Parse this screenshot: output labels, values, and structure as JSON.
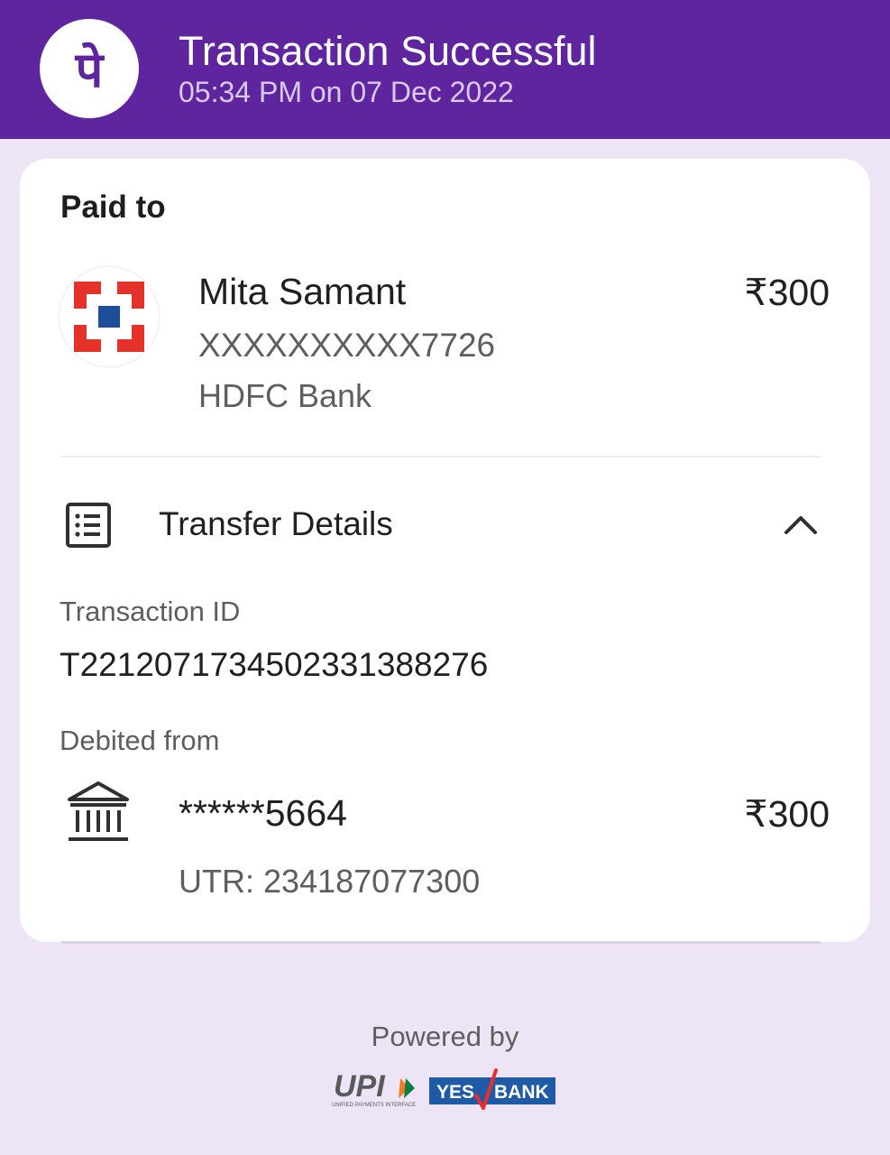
{
  "header": {
    "title": "Transaction Successful",
    "datetime": "05:34 PM on 07 Dec 2022",
    "logo_glyph": "पे",
    "logo_icon": "phonepe-logo-icon",
    "brand_color": "#5F259F"
  },
  "payee": {
    "section_label": "Paid to",
    "name": "Mita Samant",
    "account": "XXXXXXXXXX7726",
    "bank": "HDFC Bank",
    "amount": "₹300",
    "bank_logo_icon": "hdfc-bank-logo-icon"
  },
  "transfer_details": {
    "title": "Transfer Details",
    "icon": "receipt-list-icon",
    "toggle_icon": "chevron-up-icon",
    "transaction_id_label": "Transaction ID",
    "transaction_id": "T2212071734502331388276",
    "debited_from_label": "Debited from",
    "debit_account": "******5664",
    "debit_amount": "₹300",
    "utr": "UTR: 234187077300",
    "bank_icon": "bank-building-icon"
  },
  "footer": {
    "powered_by": "Powered by",
    "upi_logo": "upi-logo-icon",
    "upi_tagline": "UNIFIED PAYMENTS INTERFACE",
    "yes_bank_logo": "yes-bank-logo-icon",
    "yes_text": "YES",
    "bank_text": "BANK"
  }
}
